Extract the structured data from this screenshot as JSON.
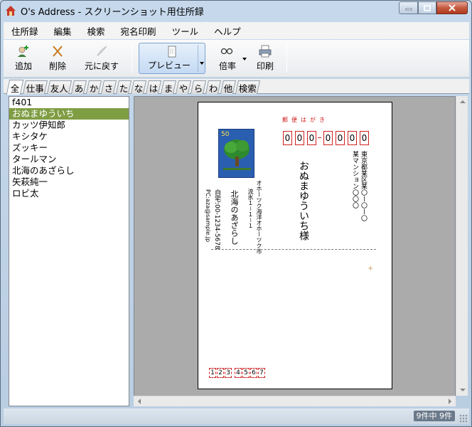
{
  "window": {
    "title": "O's Address - スクリーンショット用住所録"
  },
  "menu": [
    "住所録",
    "編集",
    "検索",
    "宛名印刷",
    "ツール",
    "ヘルプ"
  ],
  "toolbar": {
    "add_label": "追加",
    "delete_label": "削除",
    "undo_label": "元に戻す",
    "preview_label": "プレビュー",
    "zoom_label": "倍率",
    "print_label": "印刷"
  },
  "tabs": [
    "全",
    "仕事",
    "友人",
    "あ",
    "か",
    "さ",
    "た",
    "な",
    "は",
    "ま",
    "や",
    "ら",
    "わ",
    "他",
    "検索"
  ],
  "contacts": {
    "items": [
      "f401",
      "おぬまゆういち",
      "カッツ伊知郎",
      "キシタケ",
      "ズッキー",
      "タールマン",
      "北海のあざらし",
      "矢萩純一",
      "ロビ太"
    ],
    "selected_index": 1
  },
  "postcard": {
    "header": "郵便はがき",
    "zip": [
      "0",
      "0",
      "0",
      "0",
      "0",
      "0",
      "0"
    ],
    "recipient_address_1": "東京都某区某〇ー〇ー〇",
    "recipient_address_2": "某マンション〇〇〇",
    "recipient_name": "おぬまゆういち様",
    "sender_address_1": "オホーツク海洋オホーツク市",
    "sender_address_2": "流氷１－１－１",
    "sender_name": "北海のあざらし",
    "sender_phone": "自宅:00-1234-5678",
    "sender_email": "PC:aza@sample.jp",
    "sender_zip": [
      "1",
      "2",
      "3",
      "4",
      "5",
      "6",
      "7"
    ],
    "stamp_value": "50",
    "mark": "+"
  },
  "status": {
    "count_text": "9件中 9件"
  },
  "colors": {
    "selected_row": "#7f9d43",
    "postcard_red": "#d02020",
    "stamp_blue": "#2a5eb0"
  }
}
